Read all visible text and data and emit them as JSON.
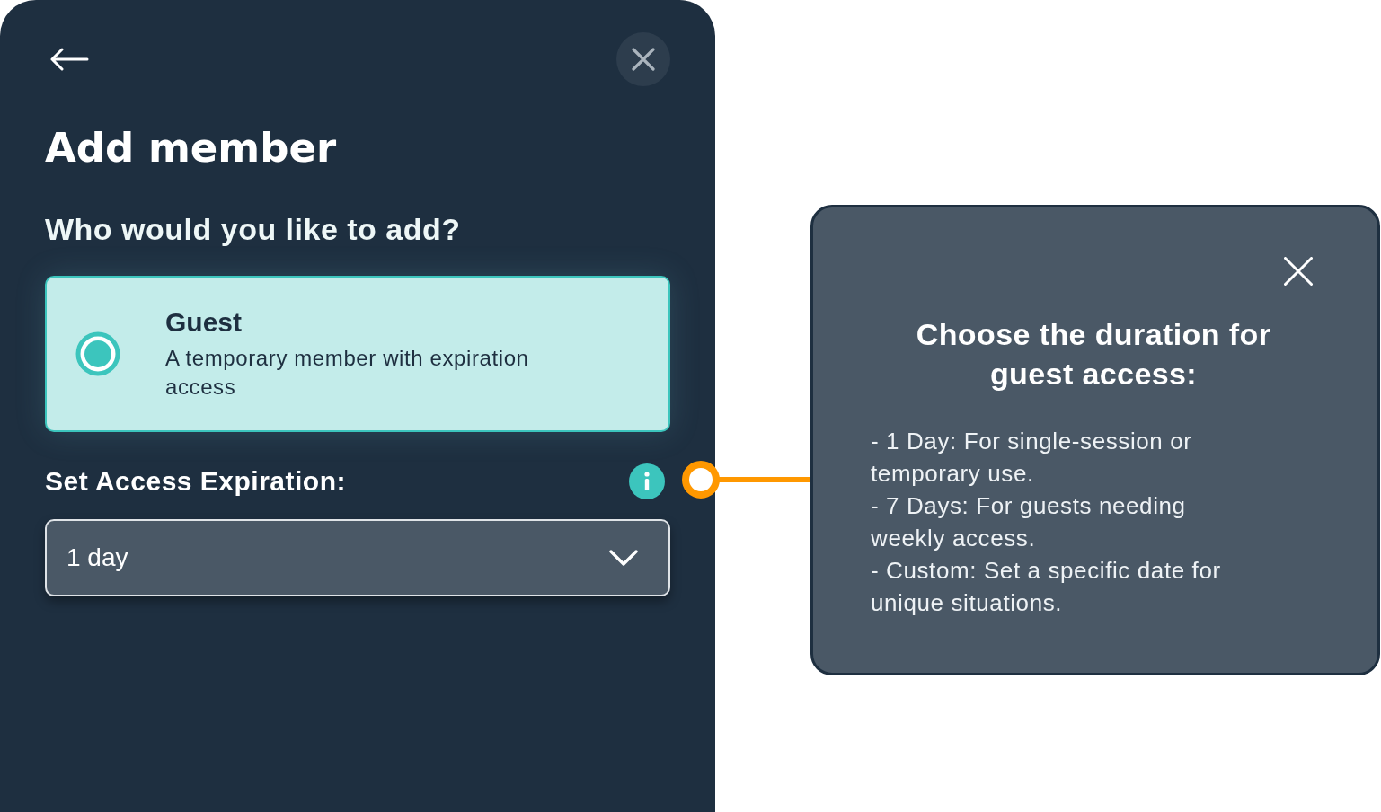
{
  "panel": {
    "title": "Add member",
    "question": "Who would you like to add?",
    "options": [
      {
        "title": "Guest",
        "description": "A temporary member with expiration access",
        "selected": true
      }
    ],
    "expiration": {
      "label": "Set Access Expiration:",
      "value": "1 day"
    }
  },
  "tooltip": {
    "title": "Choose the duration for guest access:",
    "lines": [
      "- 1 Day: For single-session or temporary use.",
      "- 7 Days: For guests needing weekly access.",
      "- Custom: Set a specific date for unique situations."
    ]
  }
}
